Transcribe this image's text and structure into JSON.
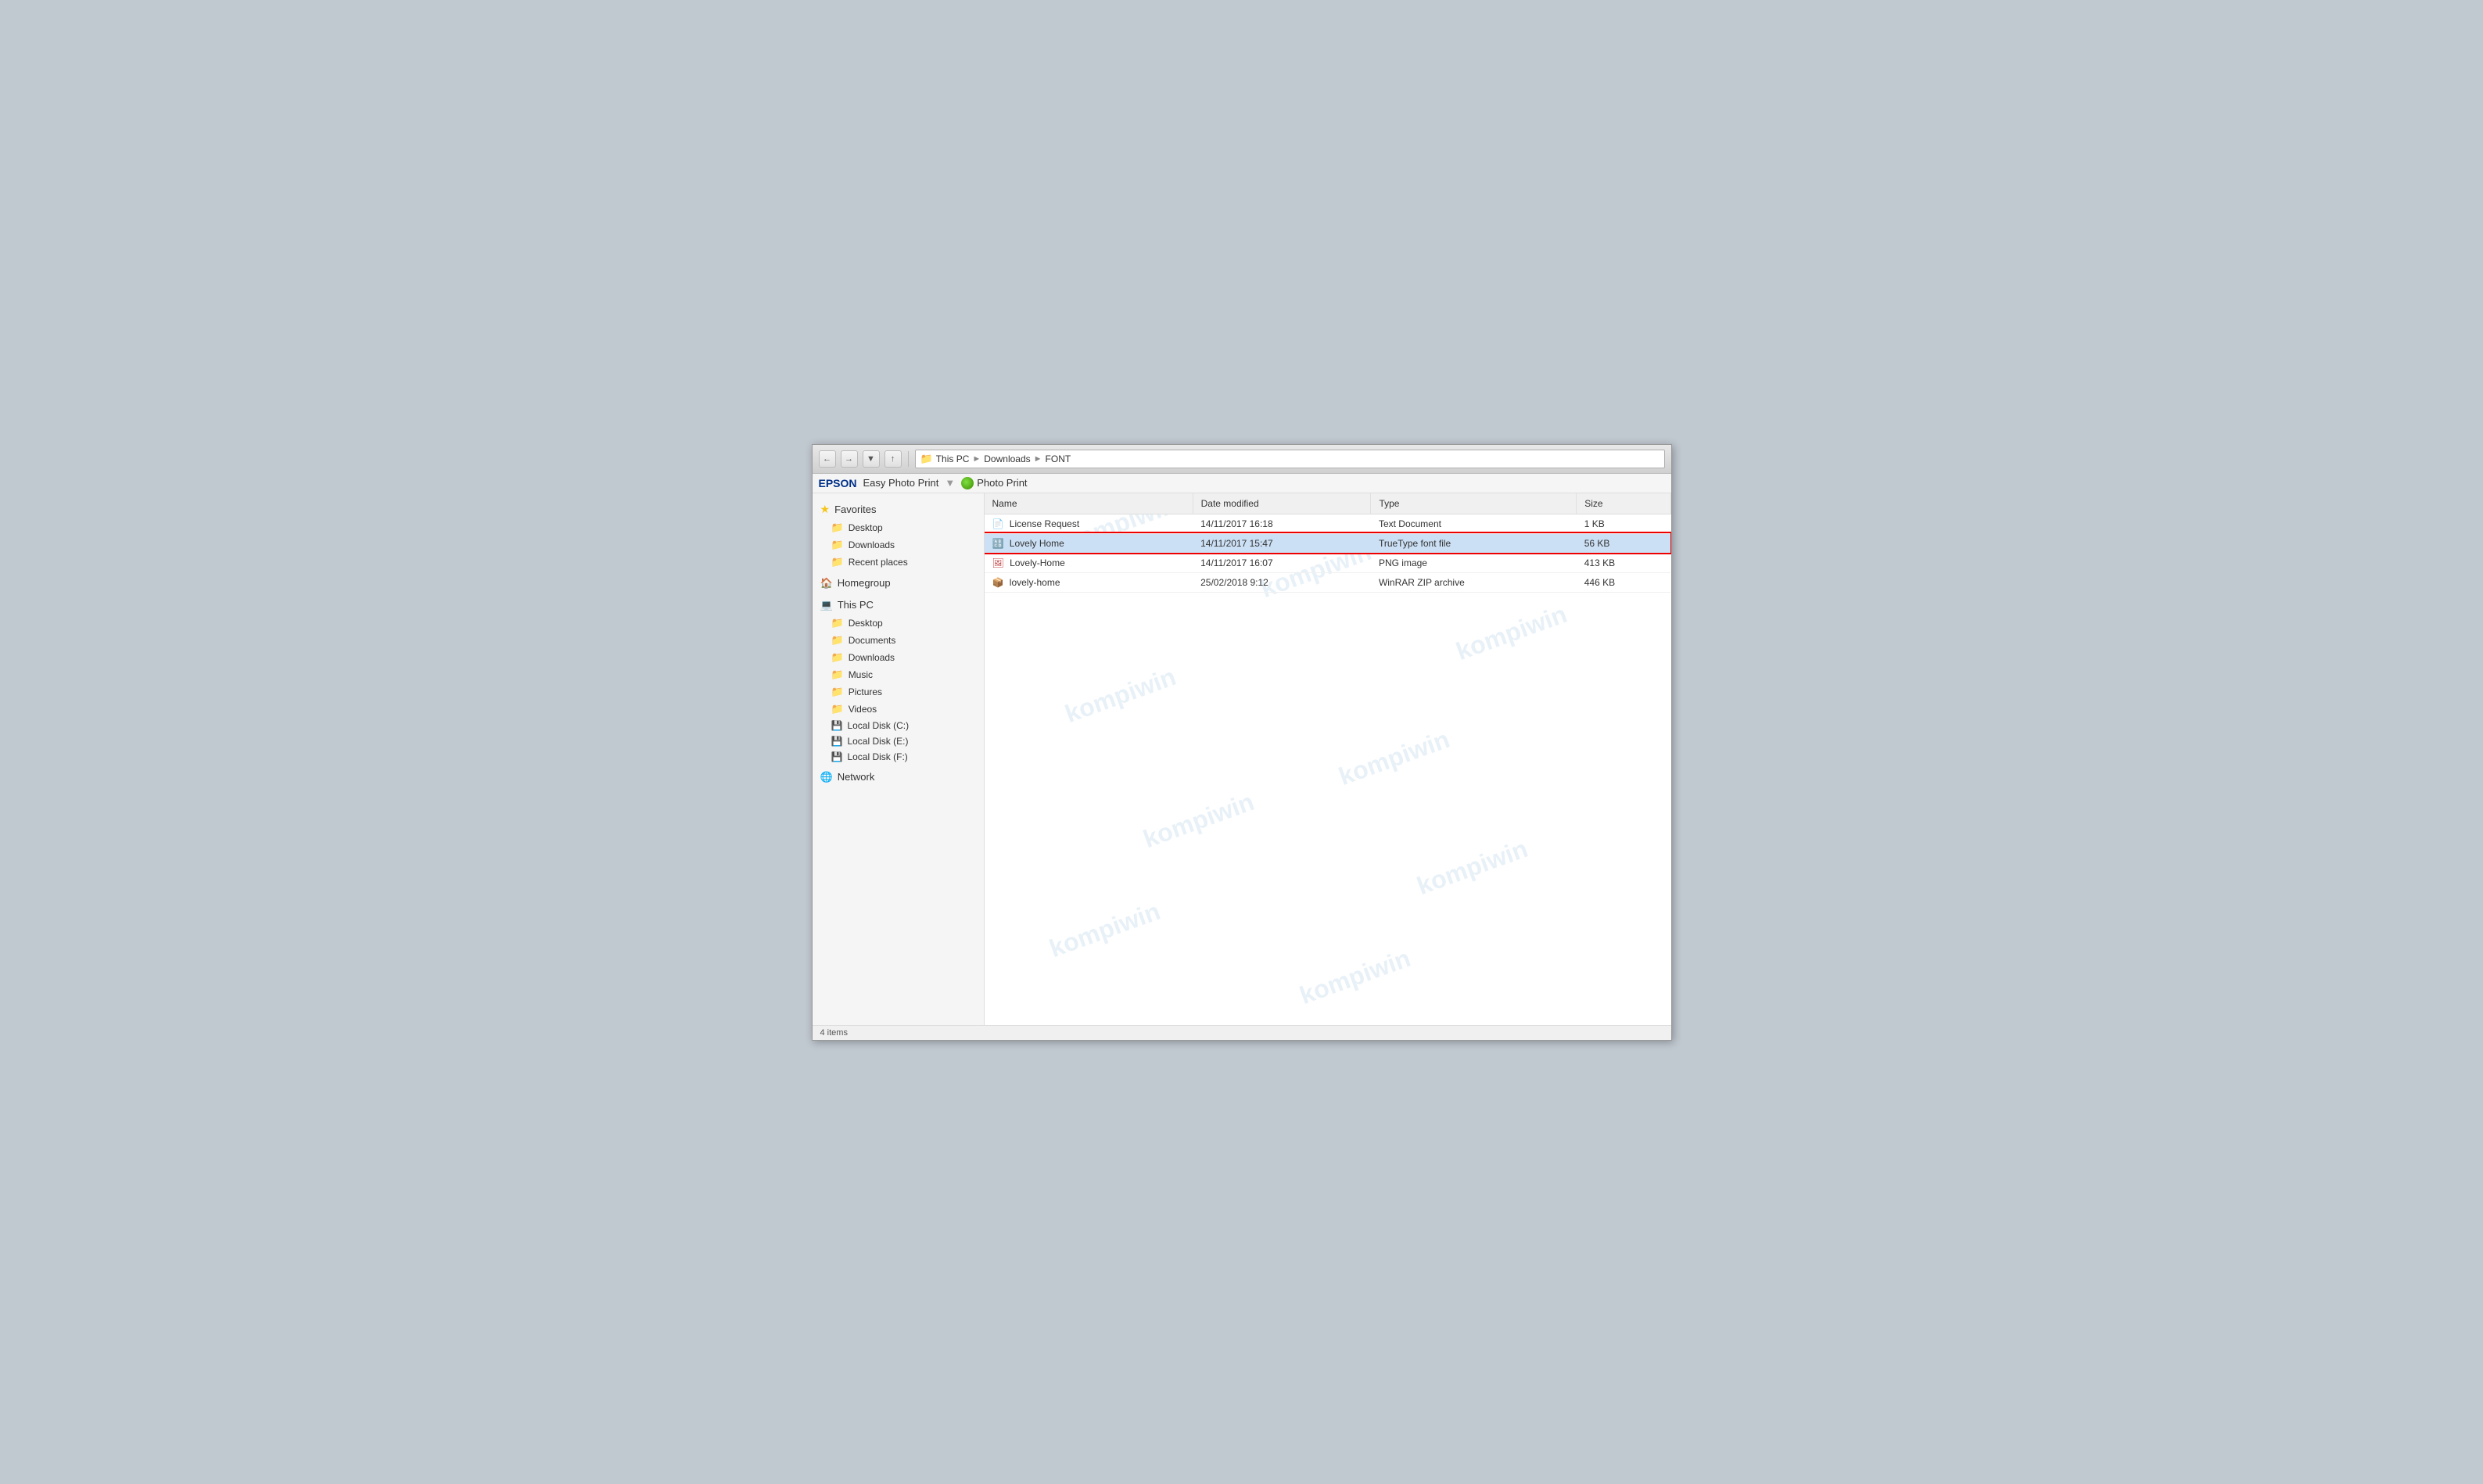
{
  "window": {
    "title": "FONT"
  },
  "toolbar": {
    "epson_label": "EPSON",
    "easy_photo": "Easy Photo Print",
    "dropdown_arrow": "▾",
    "photo_print": "Photo Print"
  },
  "address": {
    "parts": [
      "This PC",
      "Downloads",
      "FONT"
    ]
  },
  "columns": {
    "name": "Name",
    "date_modified": "Date modified",
    "type": "Type",
    "size": "Size"
  },
  "files": [
    {
      "name": "License Request",
      "date": "14/11/2017 16:18",
      "type": "Text Document",
      "size": "1 KB",
      "icon_type": "doc",
      "selected": false
    },
    {
      "name": "Lovely Home",
      "date": "14/11/2017 15:47",
      "type": "TrueType font file",
      "size": "56 KB",
      "icon_type": "font",
      "selected": true
    },
    {
      "name": "Lovely-Home",
      "date": "14/11/2017 16:07",
      "type": "PNG image",
      "size": "413 KB",
      "icon_type": "img",
      "selected": false
    },
    {
      "name": "lovely-home",
      "date": "25/02/2018 9:12",
      "type": "WinRAR ZIP archive",
      "size": "446 KB",
      "icon_type": "zip",
      "selected": false
    }
  ],
  "sidebar": {
    "favorites_label": "Favorites",
    "favorites_items": [
      {
        "label": "Desktop",
        "icon": "folder"
      },
      {
        "label": "Downloads",
        "icon": "folder"
      },
      {
        "label": "Recent places",
        "icon": "folder"
      }
    ],
    "homegroup_label": "Homegroup",
    "thispc_label": "This PC",
    "thispc_items": [
      {
        "label": "Desktop",
        "icon": "folder"
      },
      {
        "label": "Documents",
        "icon": "folder"
      },
      {
        "label": "Downloads",
        "icon": "folder"
      },
      {
        "label": "Music",
        "icon": "folder"
      },
      {
        "label": "Pictures",
        "icon": "folder"
      },
      {
        "label": "Videos",
        "icon": "folder"
      },
      {
        "label": "Local Disk (C:)",
        "icon": "disk"
      },
      {
        "label": "Local Disk (E:)",
        "icon": "disk"
      },
      {
        "label": "Local Disk (F:)",
        "icon": "disk"
      }
    ],
    "network_label": "Network"
  },
  "watermark_text": "kompiwin",
  "status": {
    "items": "4 items"
  }
}
